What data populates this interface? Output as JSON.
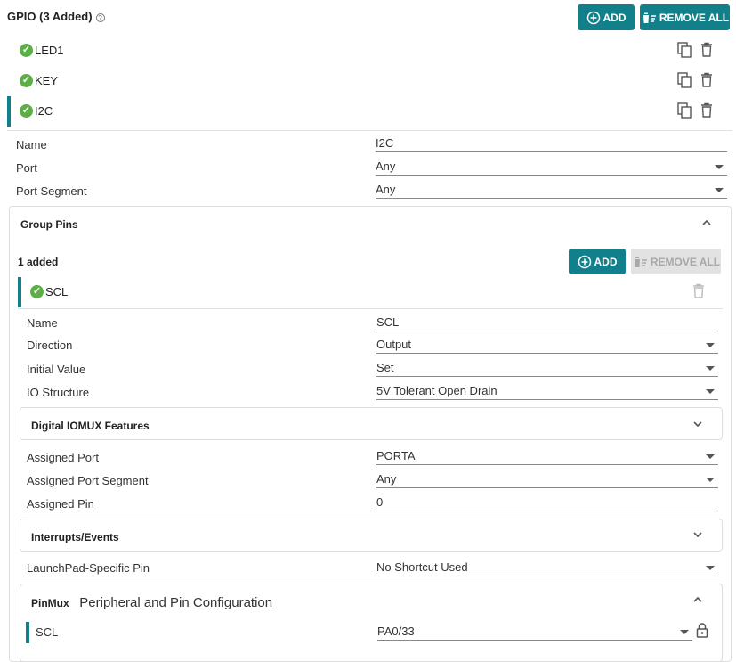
{
  "header": {
    "title": "GPIO (3 Added)",
    "help_glyph": "?",
    "add_label": "ADD",
    "remove_all_label": "REMOVE ALL"
  },
  "gpio_items": [
    {
      "label": "LED1"
    },
    {
      "label": "KEY"
    },
    {
      "label": "I2C"
    }
  ],
  "gpio_fields": {
    "name_label": "Name",
    "name_value": "I2C",
    "port_label": "Port",
    "port_value": "Any",
    "port_segment_label": "Port Segment",
    "port_segment_value": "Any"
  },
  "group_pins": {
    "title": "Group Pins",
    "added_text": "1 added",
    "add_label": "ADD",
    "remove_all_label": "REMOVE ALL",
    "pin_label": "SCL",
    "fields": {
      "name_label": "Name",
      "name_value": "SCL",
      "direction_label": "Direction",
      "direction_value": "Output",
      "initial_value_label": "Initial Value",
      "initial_value_value": "Set",
      "io_structure_label": "IO Structure",
      "io_structure_value": "5V Tolerant Open Drain"
    },
    "digital_iomux_title": "Digital IOMUX Features",
    "assigned_port_label": "Assigned Port",
    "assigned_port_value": "PORTA",
    "assigned_port_segment_label": "Assigned Port Segment",
    "assigned_port_segment_value": "Any",
    "assigned_pin_label": "Assigned Pin",
    "assigned_pin_value": "0",
    "interrupts_title": "Interrupts/Events",
    "launchpad_label": "LaunchPad-Specific Pin",
    "launchpad_value": "No Shortcut Used",
    "pinmux_title": "PinMux",
    "pinmux_subtitle": "Peripheral and Pin Configuration",
    "pinmux_signal_label": "SCL",
    "pinmux_signal_value": "PA0/33"
  },
  "colors": {
    "accent": "#12808a",
    "success": "#5cae46",
    "disabled": "#e2e2e2"
  },
  "icons": [
    "help-icon",
    "add-circle-icon",
    "remove-all-icon",
    "check-icon",
    "copy-icon",
    "trash-icon",
    "chevron-up-icon",
    "chevron-down-icon",
    "dropdown-caret-icon",
    "lock-icon"
  ]
}
